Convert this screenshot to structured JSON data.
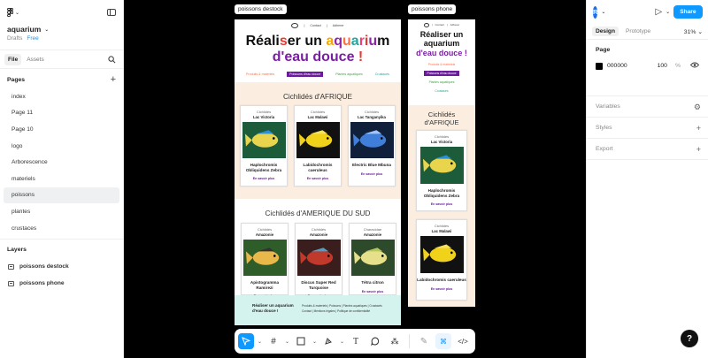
{
  "project": {
    "name": "aquarium",
    "team": "Drafts",
    "plan": "Free"
  },
  "left_tabs": {
    "file": "File",
    "assets": "Assets"
  },
  "pages": {
    "heading": "Pages",
    "items": [
      {
        "label": "index"
      },
      {
        "label": "Page 11"
      },
      {
        "label": "Page 10"
      },
      {
        "label": "logo"
      },
      {
        "label": "Arborescence"
      },
      {
        "label": "materiels"
      },
      {
        "label": "poissons"
      },
      {
        "label": "plantes"
      },
      {
        "label": "crustaces"
      }
    ],
    "selected": "poissons"
  },
  "layers": {
    "heading": "Layers",
    "items": [
      {
        "label": "poissons  destock"
      },
      {
        "label": "poissons phone"
      }
    ]
  },
  "right_panel": {
    "avatar_initial": "R",
    "share_label": "Share",
    "tabs": {
      "design": "Design",
      "prototype": "Prototype"
    },
    "zoom": "31%",
    "page_section": {
      "title": "Page",
      "color_hex": "000000",
      "opacity": "100",
      "percent_sign": "%"
    },
    "variables": "Variables",
    "styles": "Styles",
    "export": "Export"
  },
  "frames": {
    "desktop": {
      "label": "poissons  destock",
      "nav": {
        "contact": "Contact",
        "adherer": "Adherer"
      },
      "hero_line1": [
        "Réali",
        "s",
        "er un ",
        "a",
        "q",
        "u",
        "a",
        "r",
        "i",
        "u",
        "m"
      ],
      "hero_line2": [
        "d'eau douce ",
        "!"
      ],
      "categories": [
        "Produits & materiels",
        "Poissons d'eau douce",
        "Plantes aquatiques",
        "Crustacés"
      ],
      "section1_title": "Cichlidés d'AFRIQUE",
      "section1_cards": [
        {
          "family": "Cichlidés",
          "place": "Lac Victoria",
          "name": "Haplochromis Obliquidens Zebra",
          "more": "En savoir plus"
        },
        {
          "family": "Cichlidés",
          "place": "Lac Malawi",
          "name": "Labidochromis caeruleus",
          "more": "En savoir plus"
        },
        {
          "family": "Cichlidés",
          "place": "Lac Tanganyika",
          "name": "Electric Blue Mbuna",
          "more": "En savoir plus"
        }
      ],
      "section2_title": "Cichlidés d'AMERIQUE DU SUD",
      "section2_cards": [
        {
          "family": "Cichlidés",
          "place": "Amazonie",
          "name": "Apistogramma Ramirezi",
          "more": "En savoir plus"
        },
        {
          "family": "Cichlidés",
          "place": "Amazonie",
          "name": "Discus Super Red Turquoise",
          "more": "En savoir plus"
        },
        {
          "family": "Characidae",
          "place": "Amazonie",
          "name": "Tétra citron",
          "more": "En savoir plus"
        }
      ],
      "footer_title": "Réaliser un aquarium d'eau douce !",
      "footer_links1": "Produits & materiels  |  Poissons  |  Plantes aquatiques  |  Crustacés",
      "footer_links2": "Contact  |  Mentions légales  |  Politique de confidentialité"
    },
    "phone": {
      "label": "poissons phone",
      "nav": {
        "contact": "Contact",
        "adherer": "Adherer"
      },
      "hero_line1": "Réaliser un aquarium",
      "hero_line2": "d'eau douce !",
      "categories": [
        "Produits & materiels",
        "Poissons d'eau douce",
        "Plantes aquatiques",
        "Crustacés"
      ],
      "section_title": "Cichlidés d'AFRIQUE",
      "cards": [
        {
          "family": "Cichlidés",
          "place": "Lac Victoria",
          "name": "Haplochromis Obliquidens Zebra",
          "more": "En savoir plus"
        },
        {
          "family": "Cichlidés",
          "place": "Lac Malawi",
          "name": "Labidochromis caeruleus",
          "more": "En savoir plus"
        }
      ]
    }
  },
  "toolbar": {
    "tools": [
      "move-tool",
      "frame-tool",
      "shape-tool",
      "pen-tool",
      "text-tool",
      "comment-tool",
      "actions-tool",
      "draw-mode",
      "design-mode",
      "dev-mode"
    ]
  },
  "help_label": "?"
}
